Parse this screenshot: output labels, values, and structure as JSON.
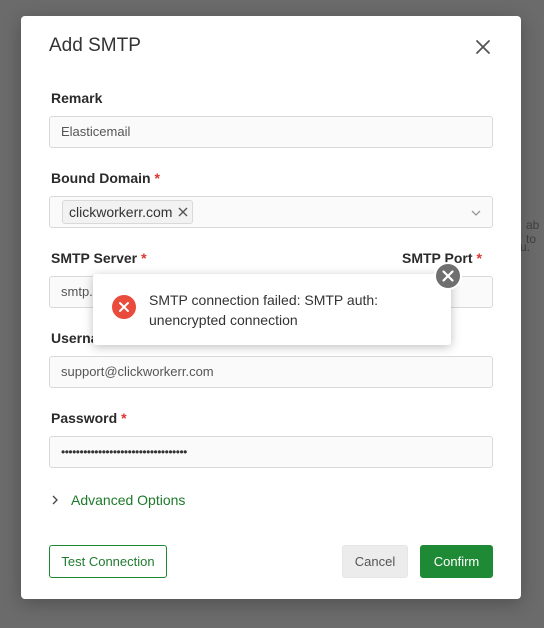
{
  "background": {
    "fragment_1": "ab to",
    "fragment_2": "u."
  },
  "modal": {
    "title": "Add SMTP",
    "close_icon": "close-icon",
    "fields": {
      "remark": {
        "label": "Remark",
        "value": "Elasticemail"
      },
      "bound_domain": {
        "label": "Bound Domain",
        "required": "*",
        "tag": "clickworkerr.com"
      },
      "smtp_server": {
        "label": "SMTP Server",
        "required": "*",
        "value_visible": "smtp."
      },
      "smtp_port": {
        "label": "SMTP Port",
        "required": "*"
      },
      "username": {
        "label_visible": "Userna",
        "value": "support@clickworkerr.com"
      },
      "password": {
        "label": "Password",
        "required": "*",
        "value": "••••••••••••••••••••••••••••••••••"
      }
    },
    "advanced_options": "Advanced Options",
    "buttons": {
      "test": "Test Connection",
      "cancel": "Cancel",
      "confirm": "Confirm"
    }
  },
  "toast": {
    "message": "SMTP connection failed: SMTP auth: unencrypted connection",
    "icon": "error-icon",
    "close_icon": "close-icon"
  },
  "colors": {
    "accent": "#1f8a35",
    "error": "#e94b3c",
    "required": "#e0342c"
  }
}
